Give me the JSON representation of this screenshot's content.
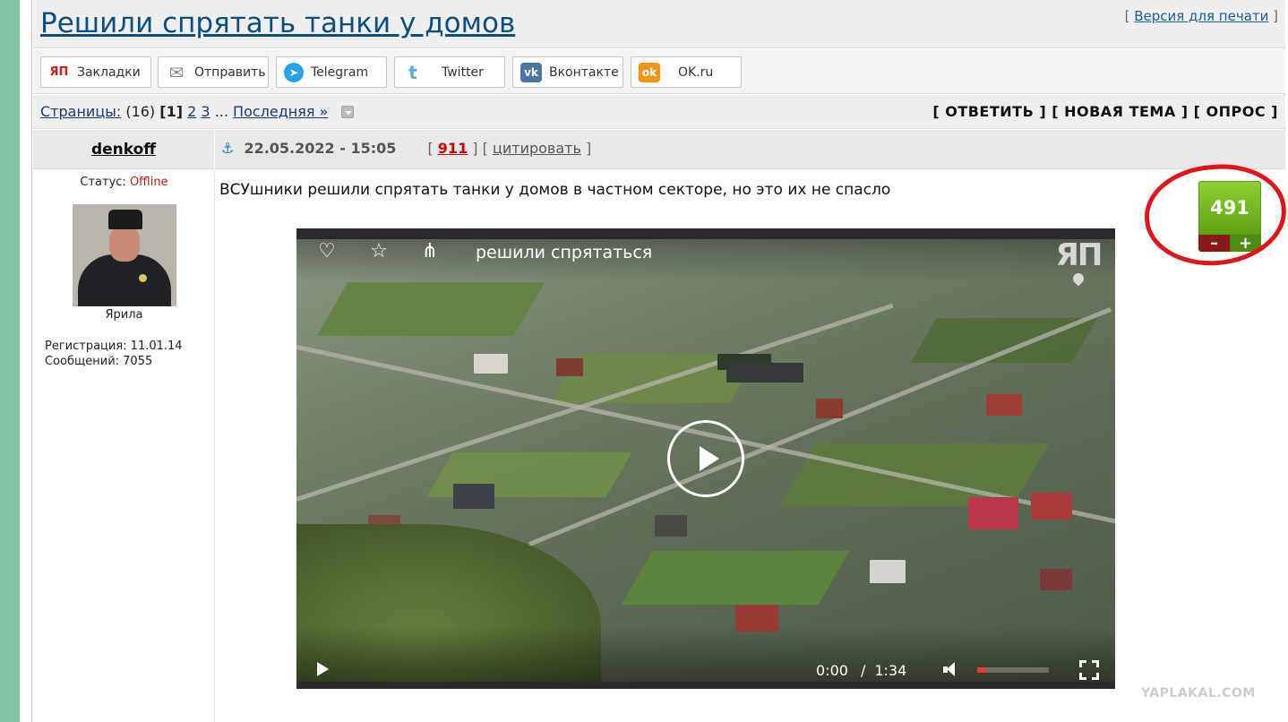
{
  "topic": {
    "title": "Решили спрятать танки у домов",
    "print_prefix": "[ ",
    "print_link": "Версия для печати",
    "print_suffix": " ]"
  },
  "share": [
    {
      "label": "Закладки",
      "icon": "yaplakal-icon",
      "glyph": "ЯП",
      "color": "#d01a1a"
    },
    {
      "label": "Отправить",
      "icon": "envelope-icon",
      "glyph": "✉",
      "color": "#8a8a8a"
    },
    {
      "label": "Telegram",
      "icon": "telegram-icon",
      "glyph": "➤",
      "color": "#2aa3e0"
    },
    {
      "label": "Twitter",
      "icon": "twitter-icon",
      "glyph": "t",
      "color": "#55acee"
    },
    {
      "label": "Вконтакте",
      "icon": "vk-icon",
      "glyph": "vk",
      "color": "#4c75a3"
    },
    {
      "label": "OK.ru",
      "icon": "odnoklassniki-icon",
      "glyph": "ok",
      "color": "#f39318"
    }
  ],
  "pagination": {
    "label": "Страницы:",
    "count": "(16)",
    "current": "[1]",
    "page2": "2",
    "page3": "3",
    "ellipsis": "...",
    "last": "Последняя »"
  },
  "actions": "[ ОТВЕТИТЬ ] [ НОВАЯ ТЕМА ] [ ОПРОС ]",
  "post": {
    "author": "denkoff",
    "date": "22.05.2022 - 15:05",
    "number": "911",
    "quote": "цитировать",
    "text": "ВСУшники решили спрятать танки у домов в частном секторе, но это их не спасло",
    "rating": "491",
    "rating_minus": "–",
    "rating_plus": "+"
  },
  "author_info": {
    "status_label": "Статус:",
    "status_value": "Offline",
    "nick": "Ярила",
    "registration": "Регистрация: 11.01.14",
    "messages": "Сообщений: 7055"
  },
  "video": {
    "title": "решили спрятаться",
    "current_time": "0:00",
    "duration": "1:34",
    "logo": "ЯП"
  },
  "watermark": "YAPLAKAL.COM"
}
